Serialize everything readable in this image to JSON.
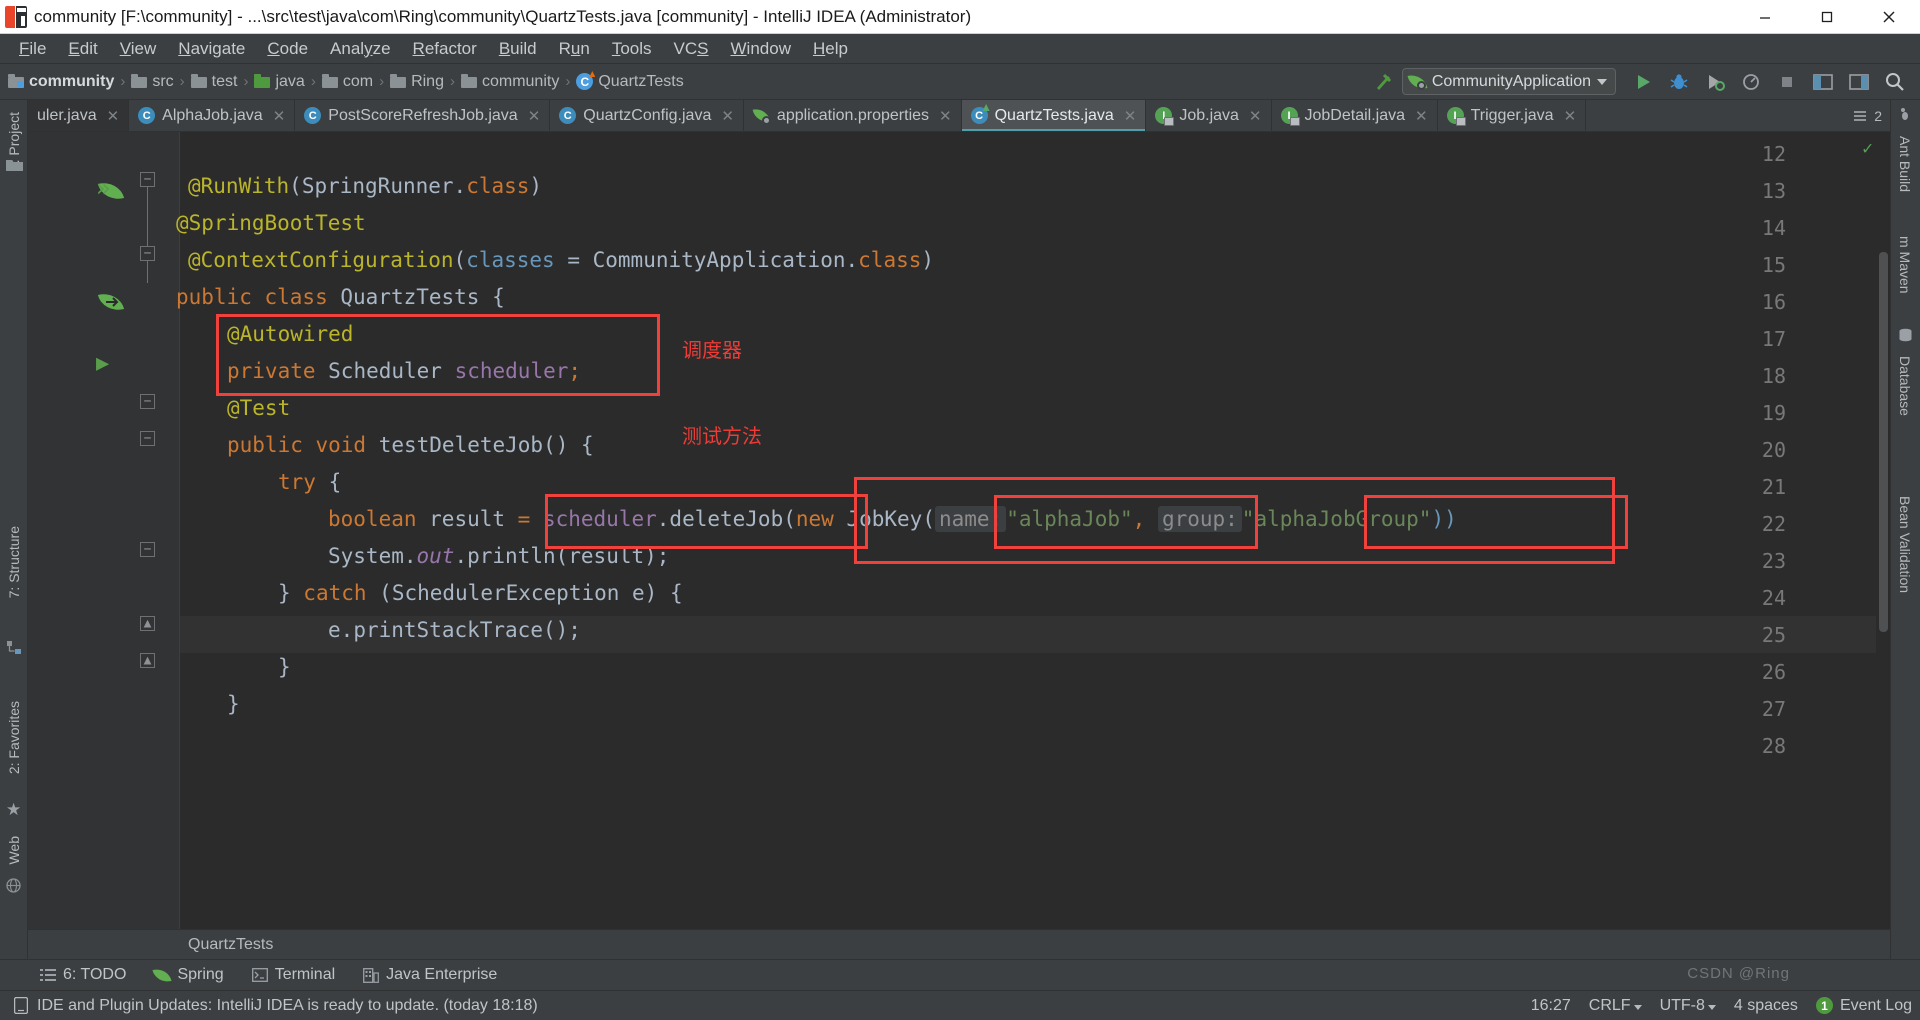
{
  "window": {
    "title": "community [F:\\community] - ...\\src\\test\\java\\com\\Ring\\community\\QuartzTests.java [community] - IntelliJ IDEA (Administrator)",
    "app_icon": "intellij-idea-icon",
    "minimize": "minimize-icon",
    "maximize": "maximize-icon",
    "close": "close-icon"
  },
  "menubar": {
    "items": [
      {
        "label": "File"
      },
      {
        "label": "Edit"
      },
      {
        "label": "View"
      },
      {
        "label": "Navigate"
      },
      {
        "label": "Code"
      },
      {
        "label": "Analyze"
      },
      {
        "label": "Refactor"
      },
      {
        "label": "Build"
      },
      {
        "label": "Run"
      },
      {
        "label": "Tools"
      },
      {
        "label": "VCS"
      },
      {
        "label": "Window"
      },
      {
        "label": "Help"
      }
    ]
  },
  "breadcrumb": {
    "items": [
      {
        "label": "community",
        "icon": "folder-module-icon"
      },
      {
        "label": "src",
        "icon": "folder-icon"
      },
      {
        "label": "test",
        "icon": "folder-icon"
      },
      {
        "label": "java",
        "icon": "folder-source-icon"
      },
      {
        "label": "com",
        "icon": "folder-icon"
      },
      {
        "label": "Ring",
        "icon": "folder-icon"
      },
      {
        "label": "community",
        "icon": "folder-icon"
      },
      {
        "label": "QuartzTests",
        "icon": "java-class-icon"
      }
    ]
  },
  "toolbar": {
    "build_icon": "hammer-icon",
    "run_config": "CommunityApplication",
    "run_config_icon": "spring-boot-icon",
    "run_button": "run-icon",
    "debug_button": "debug-icon",
    "run_coverage_button": "run-with-coverage-icon",
    "profile_button": "profiler-icon",
    "stop_button": "stop-icon",
    "layout_button": "layout-icon",
    "updates_button": "update-icon",
    "search_button": "search-icon"
  },
  "tabs": {
    "items": [
      {
        "label": "uler.java",
        "icon": "java-class-icon",
        "active": false,
        "truncated": true
      },
      {
        "label": "AlphaJob.java",
        "icon": "java-class-icon",
        "active": false
      },
      {
        "label": "PostScoreRefreshJob.java",
        "icon": "java-class-icon",
        "active": false
      },
      {
        "label": "QuartzConfig.java",
        "icon": "java-class-icon",
        "active": false
      },
      {
        "label": "application.properties",
        "icon": "spring-properties-icon",
        "active": false
      },
      {
        "label": "QuartzTests.java",
        "icon": "java-test-class-icon",
        "active": true
      },
      {
        "label": "Job.java",
        "icon": "java-interface-readonly-icon",
        "active": false
      },
      {
        "label": "JobDetail.java",
        "icon": "java-interface-readonly-icon",
        "active": false
      },
      {
        "label": "Trigger.java",
        "icon": "java-interface-readonly-icon",
        "active": false
      }
    ],
    "overflow_label": "2",
    "overflow_icon": "tab-overflow-icon"
  },
  "editor": {
    "line_numbers": [
      "12",
      "13",
      "14",
      "15",
      "16",
      "17",
      "18",
      "19",
      "20",
      "21",
      "22",
      "23",
      "24",
      "25",
      "26",
      "27",
      "28"
    ],
    "breadcrumb": "QuartzTests",
    "inspection_status": "no-errors-check-icon",
    "lines": [
      {
        "n": "12",
        "tokens": []
      },
      {
        "n": "13",
        "tokens": [
          {
            "t": "@RunWith",
            "c": "ann"
          },
          {
            "t": "(",
            "c": "pln"
          },
          {
            "t": "SpringRunner",
            "c": "typ"
          },
          {
            "t": ".",
            "c": "pln"
          },
          {
            "t": "class",
            "c": "kw"
          },
          {
            "t": ")",
            "c": "pln"
          }
        ]
      },
      {
        "n": "14",
        "tokens": [
          {
            "t": "@SpringBootTest",
            "c": "ann"
          }
        ]
      },
      {
        "n": "15",
        "tokens": [
          {
            "t": "@ContextConfiguration",
            "c": "ann"
          },
          {
            "t": "(",
            "c": "pln"
          },
          {
            "t": "classes",
            "c": "num2"
          },
          {
            "t": " = ",
            "c": "pln"
          },
          {
            "t": "CommunityApplication",
            "c": "typ"
          },
          {
            "t": ".",
            "c": "pln"
          },
          {
            "t": "class",
            "c": "kw"
          },
          {
            "t": ")",
            "c": "pln"
          }
        ]
      },
      {
        "n": "16",
        "tokens": [
          {
            "t": "public class ",
            "c": "kw"
          },
          {
            "t": "QuartzTests",
            "c": "typ"
          },
          {
            "t": " {",
            "c": "pln"
          }
        ]
      },
      {
        "n": "17",
        "tokens": [
          {
            "t": "    @Autowired",
            "c": "ann"
          }
        ]
      },
      {
        "n": "18",
        "tokens": [
          {
            "t": "    private ",
            "c": "kw"
          },
          {
            "t": "Scheduler ",
            "c": "typ"
          },
          {
            "t": "scheduler",
            "c": "fld"
          },
          {
            "t": ";",
            "c": "kw"
          }
        ]
      },
      {
        "n": "19",
        "tokens": [
          {
            "t": "    @Test",
            "c": "ann"
          }
        ]
      },
      {
        "n": "20",
        "tokens": [
          {
            "t": "    public void ",
            "c": "kw"
          },
          {
            "t": "testDeleteJob",
            "c": "typ"
          },
          {
            "t": "() {",
            "c": "pln"
          }
        ]
      },
      {
        "n": "21",
        "tokens": [
          {
            "t": "        try ",
            "c": "kw"
          },
          {
            "t": "{",
            "c": "pln"
          }
        ]
      },
      {
        "n": "22",
        "tokens": [
          {
            "t": "            boolean ",
            "c": "kw"
          },
          {
            "t": "result ",
            "c": "pln"
          },
          {
            "t": "= ",
            "c": "kw"
          },
          {
            "t": "scheduler",
            "c": "fld"
          },
          {
            "t": ".",
            "c": "pln"
          },
          {
            "t": "deleteJob",
            "c": "typ"
          },
          {
            "t": "(",
            "c": "pln"
          },
          {
            "t": "new ",
            "c": "kw"
          },
          {
            "t": "JobKey",
            "c": "typ"
          },
          {
            "t": "(",
            "c": "pln"
          }
        ]
      },
      {
        "n": "23",
        "tokens": [
          {
            "t": "            System",
            "c": "pln"
          },
          {
            "t": ".",
            "c": "pln"
          },
          {
            "t": "out",
            "c": "fld"
          },
          {
            "t": ".",
            "c": "pln"
          },
          {
            "t": "println",
            "c": "typ"
          },
          {
            "t": "(result);",
            "c": "pln"
          }
        ]
      },
      {
        "n": "24",
        "tokens": [
          {
            "t": "        } ",
            "c": "pln"
          },
          {
            "t": "catch ",
            "c": "kw"
          },
          {
            "t": "(",
            "c": "pln"
          },
          {
            "t": "SchedulerException",
            "c": "typ"
          },
          {
            "t": " e) {",
            "c": "pln"
          }
        ]
      },
      {
        "n": "25",
        "tokens": [
          {
            "t": "            e",
            "c": "pln"
          },
          {
            "t": ".",
            "c": "pln"
          },
          {
            "t": "printStackTrace",
            "c": "typ"
          },
          {
            "t": "();",
            "c": "pln"
          }
        ]
      },
      {
        "n": "26",
        "tokens": [
          {
            "t": "        }",
            "c": "pln"
          }
        ]
      },
      {
        "n": "27",
        "tokens": [
          {
            "t": "    }",
            "c": "pln"
          }
        ]
      },
      {
        "n": "28",
        "tokens": []
      }
    ],
    "code": {
      "l13_at": "@RunWith",
      "l13_open": "(",
      "l13_type": "SpringRunner",
      "l13_dot": ".",
      "l13_class": "class",
      "l13_close": ")",
      "l14_at": "@SpringBootTest",
      "l15_at": "@ContextConfiguration",
      "l15_open": "(",
      "l15_param": "classes",
      "l15_eq": " = ",
      "l15_type": "CommunityApplication",
      "l15_dot": ".",
      "l15_class": "class",
      "l15_close": ")",
      "l16_kw": "public class ",
      "l16_name": "QuartzTests",
      "l16_brace": " {",
      "l17_at": "@Autowired",
      "l18_kw": "private ",
      "l18_type": "Scheduler ",
      "l18_field": "scheduler",
      "l18_semi": ";",
      "l19_at": "@Test",
      "l20_kw": "public void ",
      "l20_name": "testDeleteJob",
      "l20_rest": "() {",
      "l21_kw": "try ",
      "l21_brace": "{",
      "l22_kw": "boolean ",
      "l22_var": "result ",
      "l22_eq": "= ",
      "l22_recv": "scheduler",
      "l22_dot": ".",
      "l22_method": "deleteJob",
      "l22_open": "(",
      "l22_new": "new ",
      "l22_jobkey": "JobKey",
      "l22_open2": "(",
      "l22_hint_name": "name:",
      "l22_str_name": "\"alphaJob\"",
      "l22_comma": ",",
      "l22_hint_group": "group:",
      "l22_str_group": "\"alphaJobGroup\"",
      "l22_close": "))",
      "l23_sys": "System",
      "l23_dot1": ".",
      "l23_out": "out",
      "l23_dot2": ".",
      "l23_println": "println",
      "l23_rest": "(result);",
      "l24_close": "} ",
      "l24_catch": "catch ",
      "l24_open": "(",
      "l24_exc": "SchedulerException",
      "l24_rest": " e) {",
      "l25_e": "e",
      "l25_dot": ".",
      "l25_method": "printStackTrace",
      "l25_rest": "();",
      "l26_brace": "}",
      "l27_brace": "}"
    },
    "annotations": [
      {
        "text": "调度器",
        "name": "annotation-scheduler-label"
      },
      {
        "text": "测试方法",
        "name": "annotation-test-method-label"
      }
    ]
  },
  "left_strip": {
    "project_tab": "1: Project",
    "structure_tab": "7: Structure",
    "favorites_tab": "2: Favorites",
    "web_tab": "Web"
  },
  "right_strip": {
    "ant_build_tab": "Ant Build",
    "maven_tab": "m Maven",
    "database_tab": "Database",
    "bean_validation_tab": "Bean Validation"
  },
  "bottom_toolwindows": {
    "items": [
      {
        "label": "6: TODO",
        "icon": "todo-icon"
      },
      {
        "label": "Spring",
        "icon": "spring-icon"
      },
      {
        "label": "Terminal",
        "icon": "terminal-icon"
      },
      {
        "label": "Java Enterprise",
        "icon": "java-enterprise-icon"
      }
    ]
  },
  "statusbar": {
    "message": "IDE and Plugin Updates: IntelliJ IDEA is ready to update. (today 18:18)",
    "message_icon": "notification-icon",
    "time": "16:27",
    "line_separator": "CRLF",
    "encoding": "UTF-8",
    "indent": "4 spaces",
    "event_log": "Event Log",
    "event_log_count": "1",
    "watermark": "CSDN @Ring"
  },
  "colors": {
    "accent_red": "#f0413c",
    "editor_bg": "#2b2b2b",
    "chrome_bg": "#3c3f41",
    "gutter_bg": "#313335",
    "annotation_yellow": "#bbb529",
    "keyword_orange": "#cc7832",
    "string_green": "#6a8759",
    "field_purple": "#9876aa",
    "type_blue": "#a9b7c6",
    "tab_active_underline": "#4f9fad"
  }
}
